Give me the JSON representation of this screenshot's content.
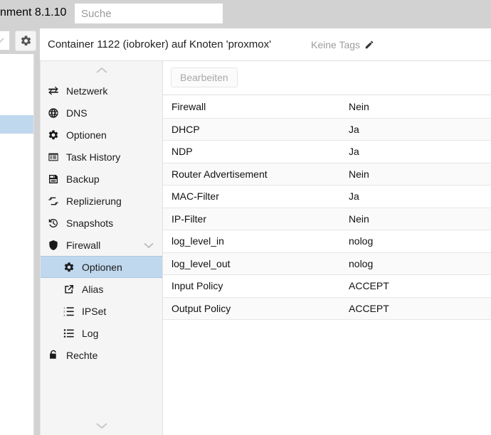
{
  "topbar": {
    "brand_version": "nment 8.1.10",
    "search_placeholder": "Suche",
    "search_value": "",
    "gear_icon": "gear-icon",
    "chevron_icon": "chevron-icon"
  },
  "content_header": {
    "title": "Container 1122 (iobroker) auf Knoten 'proxmox'",
    "tags_label": "Keine Tags",
    "tags_edit_icon": "pencil-icon"
  },
  "sidebar": {
    "scroll_up_icon": "chevron-up-icon",
    "scroll_down_icon": "chevron-down-icon",
    "partial_item": {
      "label": "-",
      "icon": "dash-icon"
    },
    "items": [
      {
        "label": "Netzwerk",
        "icon": "network-exchange-icon",
        "level": 0,
        "selected": false,
        "caret": false
      },
      {
        "label": "DNS",
        "icon": "globe-icon",
        "level": 0,
        "selected": false,
        "caret": false
      },
      {
        "label": "Optionen",
        "icon": "gear-icon",
        "level": 0,
        "selected": false,
        "caret": false
      },
      {
        "label": "Task History",
        "icon": "list-window-icon",
        "level": 0,
        "selected": false,
        "caret": false
      },
      {
        "label": "Backup",
        "icon": "floppy-disk-icon",
        "level": 0,
        "selected": false,
        "caret": false
      },
      {
        "label": "Replizierung",
        "icon": "retweet-icon",
        "level": 0,
        "selected": false,
        "caret": false
      },
      {
        "label": "Snapshots",
        "icon": "history-clock-icon",
        "level": 0,
        "selected": false,
        "caret": false
      },
      {
        "label": "Firewall",
        "icon": "shield-icon",
        "level": 0,
        "selected": false,
        "caret": true
      },
      {
        "label": "Optionen",
        "icon": "gear-icon",
        "level": 1,
        "selected": true,
        "caret": false
      },
      {
        "label": "Alias",
        "icon": "external-link-icon",
        "level": 1,
        "selected": false,
        "caret": false
      },
      {
        "label": "IPSet",
        "icon": "ordered-list-icon",
        "level": 1,
        "selected": false,
        "caret": false
      },
      {
        "label": "Log",
        "icon": "unordered-list-icon",
        "level": 1,
        "selected": false,
        "caret": false
      },
      {
        "label": "Rechte",
        "icon": "unlock-icon",
        "level": 0,
        "selected": false,
        "caret": false
      }
    ]
  },
  "main": {
    "toolbar": {
      "edit_label": "Bearbeiten",
      "edit_disabled": true
    },
    "table": {
      "rows": [
        {
          "key": "Firewall",
          "value": "Nein"
        },
        {
          "key": "DHCP",
          "value": "Ja"
        },
        {
          "key": "NDP",
          "value": "Ja"
        },
        {
          "key": "Router Advertisement",
          "value": "Nein"
        },
        {
          "key": "MAC-Filter",
          "value": "Ja"
        },
        {
          "key": "IP-Filter",
          "value": "Nein"
        },
        {
          "key": "log_level_in",
          "value": "nolog"
        },
        {
          "key": "log_level_out",
          "value": "nolog"
        },
        {
          "key": "Input Policy",
          "value": "ACCEPT"
        },
        {
          "key": "Output Policy",
          "value": "ACCEPT"
        }
      ]
    }
  },
  "colors": {
    "topbar_bg": "#d2d2d2",
    "selection_blue": "#c0d8ee",
    "row_alt": "#fafafa",
    "border": "#e0e0e0",
    "muted_text": "#9d9d9d",
    "disabled_text": "#a8a8a8"
  }
}
